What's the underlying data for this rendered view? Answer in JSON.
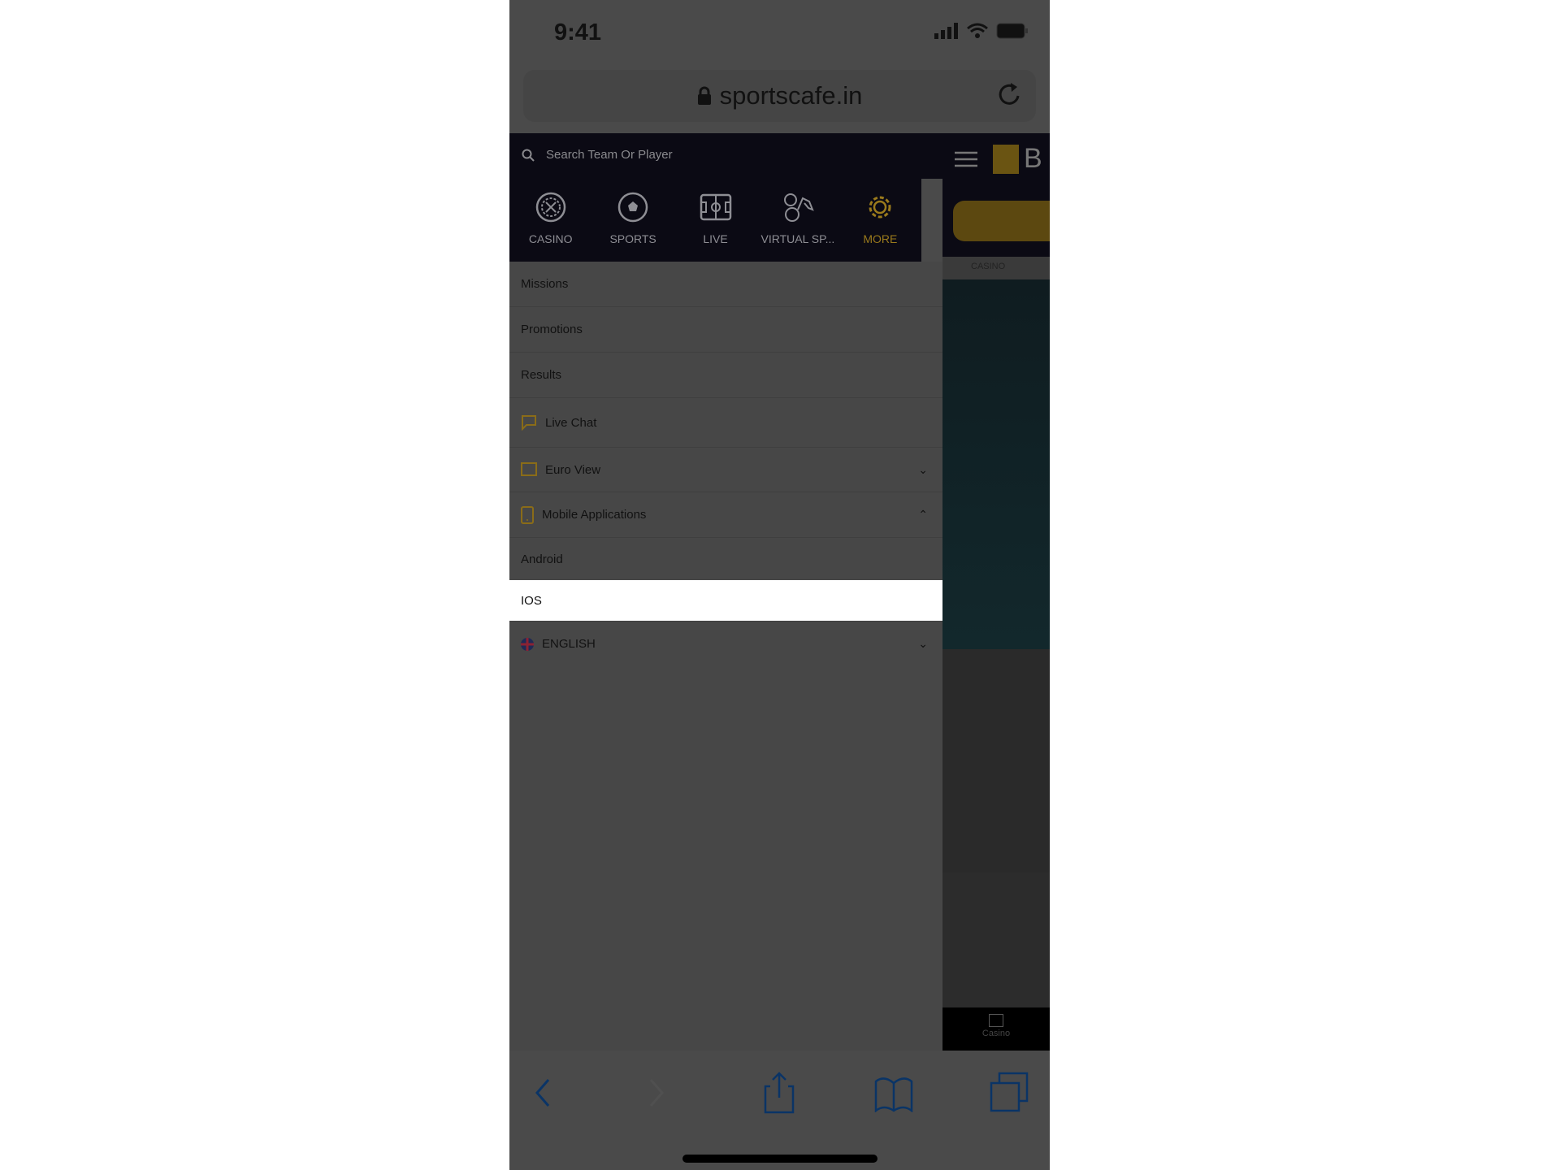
{
  "status": {
    "time": "9:41"
  },
  "browser": {
    "url": "sportscafe.in"
  },
  "search": {
    "placeholder": "Search Team Or Player"
  },
  "categories": [
    {
      "label": "CASINO",
      "icon": "roulette-icon"
    },
    {
      "label": "SPORTS",
      "icon": "soccer-ball-icon"
    },
    {
      "label": "LIVE",
      "icon": "field-icon"
    },
    {
      "label": "VIRTUAL SP...",
      "icon": "virtual-sports-icon"
    },
    {
      "label": "MORE",
      "icon": "gear-icon",
      "active": true
    }
  ],
  "menu": {
    "items": [
      "Missions",
      "Promotions",
      "Results",
      "Live Chat",
      "Euro View",
      "Mobile Applications",
      "Android",
      "IOS",
      "ENGLISH"
    ]
  },
  "background_page": {
    "tab": "CASINO",
    "logo_text": "B",
    "bottom_nav": "Casino"
  },
  "colors": {
    "accent": "#9a7a1c",
    "nav_bg": "#0b0a14",
    "toolbar_icon": "#0a3466"
  }
}
